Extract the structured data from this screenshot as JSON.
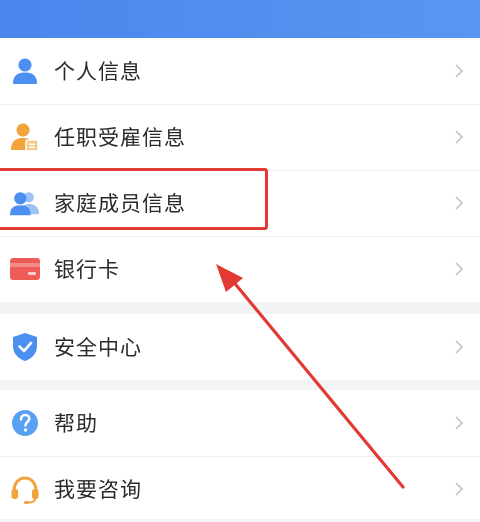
{
  "menu": {
    "items": [
      {
        "label": "个人信息",
        "icon": "user-icon"
      },
      {
        "label": "任职受雇信息",
        "icon": "employee-badge-icon"
      },
      {
        "label": "家庭成员信息",
        "icon": "family-members-icon"
      },
      {
        "label": "银行卡",
        "icon": "bank-card-icon"
      }
    ],
    "security": {
      "label": "安全中心",
      "icon": "shield-check-icon"
    },
    "help": {
      "label": "帮助",
      "icon": "question-icon"
    },
    "consult": {
      "label": "我要咨询",
      "icon": "headset-icon"
    }
  },
  "colors": {
    "header": "#4a86ec",
    "accent_blue": "#4b8ff0",
    "orange": "#f2a23a",
    "red_card": "#ef5b57",
    "annotation_red": "#e23a33"
  }
}
